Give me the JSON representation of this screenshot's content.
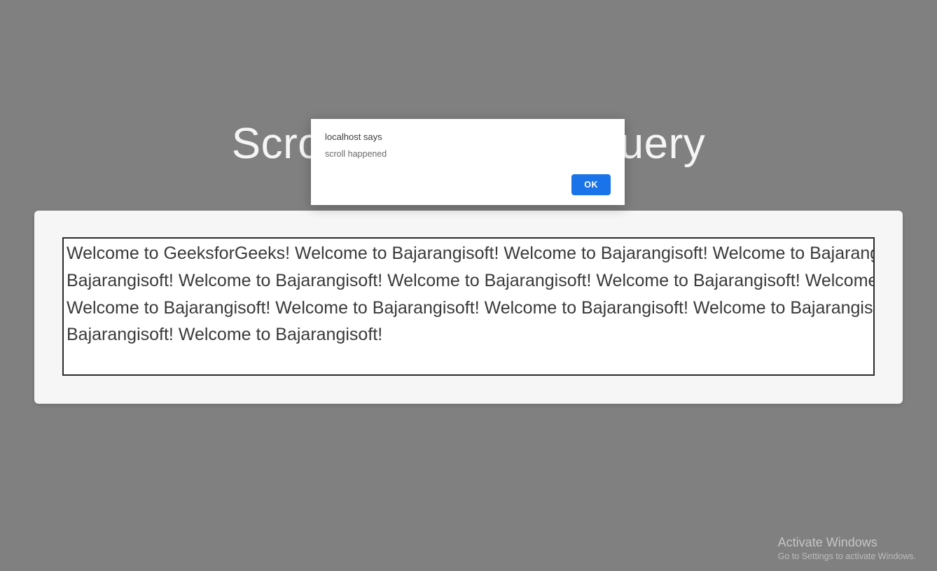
{
  "dialog": {
    "title": "localhost says",
    "message": "scroll happened",
    "ok_label": "OK"
  },
  "page": {
    "heading": "Scroll Method In JQuery",
    "scroll_text": "Welcome to GeeksforGeeks! Welcome to Bajarangisoft! Welcome to Bajarangisoft! Welcome to Bajarangisoft! Welcome to Bajarangisoft! Welcome to Bajarangisoft! Welcome to Bajarangisoft! Welcome to Bajarangisoft! Welcome to Bajarangisoft! Welcome to Bajarangisoft! Welcome to Bajarangisoft! Welcome to Bajarangisoft! Welcome to Bajarangisoft! Welcome to Bajarangisoft! Welcome to Bajarangisoft!"
  },
  "watermark": {
    "title": "Activate Windows",
    "subtitle": "Go to Settings to activate Windows."
  }
}
